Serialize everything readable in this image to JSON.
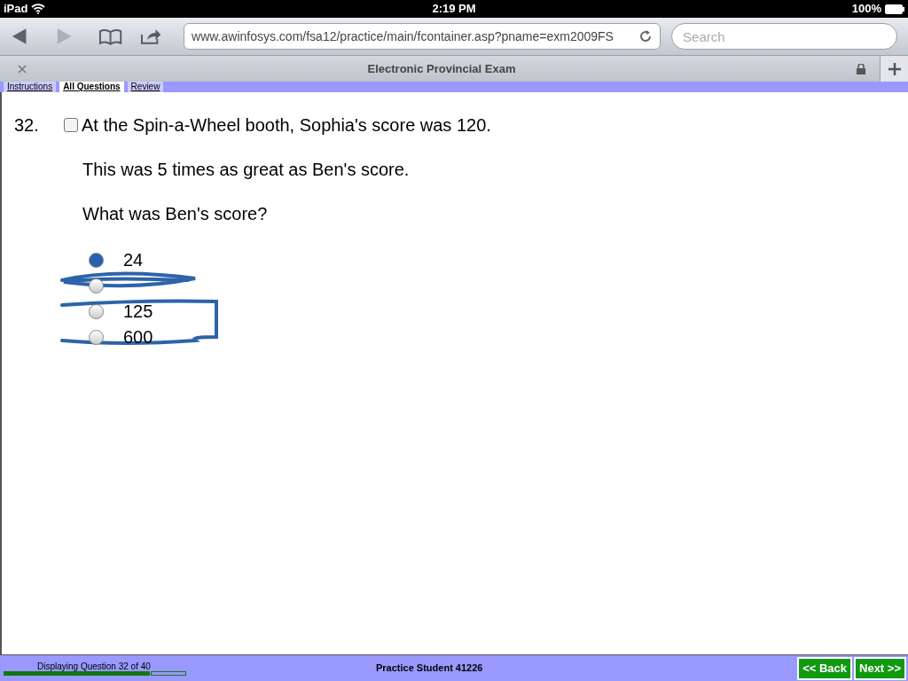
{
  "status_bar": {
    "device": "iPad",
    "time": "2:19 PM",
    "battery": "100%"
  },
  "browser": {
    "url": "www.awinfosys.com/fsa12/practice/main/fcontainer.asp?pname=exm2009FS",
    "search_placeholder": "Search",
    "tab_title": "Electronic Provincial Exam"
  },
  "exam_tabs": [
    {
      "label": "Instructions",
      "selected": false
    },
    {
      "label": "All Questions",
      "selected": true
    },
    {
      "label": "Review",
      "selected": false
    }
  ],
  "question": {
    "number": "32.",
    "flagged": false,
    "lines": [
      "At the Spin-a-Wheel booth, Sophia's score was 120.",
      "This was 5 times as great as Ben's score.",
      "What was Ben's score?"
    ],
    "choices": [
      {
        "label": "24",
        "selected": true
      },
      {
        "selected": false
      },
      {
        "label": "125",
        "selected": false
      },
      {
        "label": "600",
        "selected": false
      }
    ]
  },
  "footer": {
    "progress_text": "Displaying Question 32 of 40",
    "progress": {
      "level": 0.8
    },
    "student": "Practice Student 41226",
    "buttons": [
      "<< Back",
      "Next >>"
    ]
  }
}
